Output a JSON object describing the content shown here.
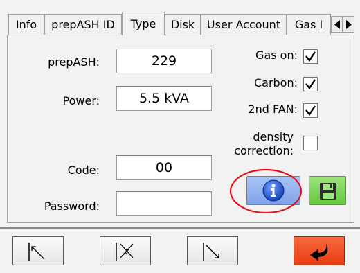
{
  "tabs": [
    {
      "label": "Info"
    },
    {
      "label": "prepASH ID"
    },
    {
      "label": "Type",
      "active": true
    },
    {
      "label": "Disk"
    },
    {
      "label": "User Account"
    },
    {
      "label": "Gas I"
    }
  ],
  "form": {
    "prepash_label": "prepASH:",
    "prepash_value": "229",
    "power_label": "Power:",
    "power_value": "5.5 kVA",
    "code_label": "Code:",
    "code_value": "00",
    "password_label": "Password:",
    "password_value": ""
  },
  "options": {
    "gas_on_label": "Gas on:",
    "gas_on_checked": true,
    "carbon_label": "Carbon:",
    "carbon_checked": true,
    "fan2_label": "2nd FAN:",
    "fan2_checked": true,
    "density_label_line1": "density",
    "density_label_line2": "correction:",
    "density_checked": false
  },
  "icons": {
    "info": "info-icon",
    "save": "floppy-disk-icon",
    "arrow_up_left": "arrow-up-left-icon",
    "arrow_collapse": "arrows-collapse-icon",
    "arrow_down_right": "arrow-down-right-icon",
    "enter": "enter-return-icon"
  },
  "colors": {
    "info_button": "#8fb0f0",
    "save_button": "#7ed957",
    "enter_button": "#f04a1c",
    "highlight_circle": "#e0141e"
  }
}
